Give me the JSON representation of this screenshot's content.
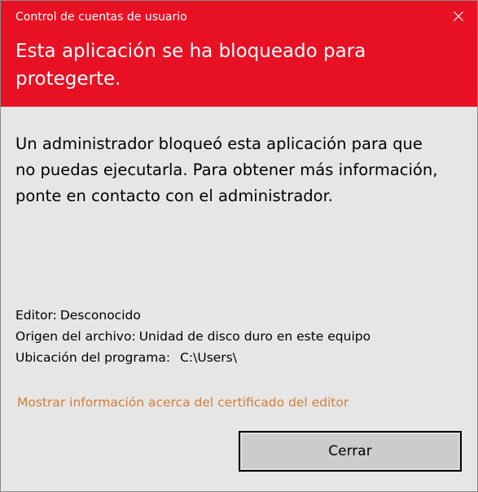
{
  "window": {
    "title": "Control de cuentas de usuario",
    "close_icon": "close-icon"
  },
  "header": {
    "heading": "Esta aplicación se ha bloqueado para protegerte.",
    "background_color": "#e81123"
  },
  "body": {
    "message": "Un administrador bloqueó esta aplicación para que no puedas ejecutarla. Para obtener más información, ponte en contacto con el administrador."
  },
  "details": {
    "publisher_label": "Editor:",
    "publisher_value": "Desconocido",
    "origin_label": "Origen del archivo:",
    "origin_value": "Unidad de disco duro en este equipo",
    "location_label": "Ubicación del programa:",
    "location_value": "C:\\Users\\"
  },
  "link": {
    "certificate_text": "Mostrar información acerca del certificado del editor",
    "color": "#d17f3a"
  },
  "buttons": {
    "close_label": "Cerrar"
  }
}
